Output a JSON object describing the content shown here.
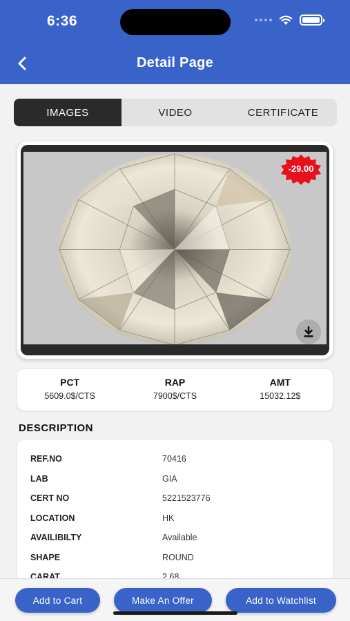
{
  "status_bar": {
    "time": "6:36"
  },
  "header": {
    "title": "Detail Page",
    "back_icon": "chevron-left-icon"
  },
  "tabs": [
    {
      "label": "IMAGES",
      "active": true
    },
    {
      "label": "VIDEO",
      "active": false
    },
    {
      "label": "CERTIFICATE",
      "active": false
    }
  ],
  "media": {
    "discount": "-29.00",
    "download_icon": "download-icon"
  },
  "prices": [
    {
      "label": "PCT",
      "value": "5609.0$/CTS"
    },
    {
      "label": "RAP",
      "value": "7900$/CTS"
    },
    {
      "label": "AMT",
      "value": "15032.12$"
    }
  ],
  "description": {
    "heading": "DESCRIPTION",
    "rows": [
      {
        "key": "REF.NO",
        "value": "70416"
      },
      {
        "key": "LAB",
        "value": "GIA"
      },
      {
        "key": "CERT NO",
        "value": "5221523776"
      },
      {
        "key": "LOCATION",
        "value": "HK"
      },
      {
        "key": "AVAILIBILTY",
        "value": "Available"
      },
      {
        "key": "SHAPE",
        "value": "ROUND"
      },
      {
        "key": "CARAT",
        "value": "2.68"
      }
    ]
  },
  "actions": {
    "add_to_cart": "Add to Cart",
    "make_offer": "Make An Offer",
    "add_to_watchlist": "Add to Watchlist"
  },
  "colors": {
    "primary": "#3a63c9",
    "badge": "#e8101b",
    "tab_active": "#2a2a2a"
  }
}
